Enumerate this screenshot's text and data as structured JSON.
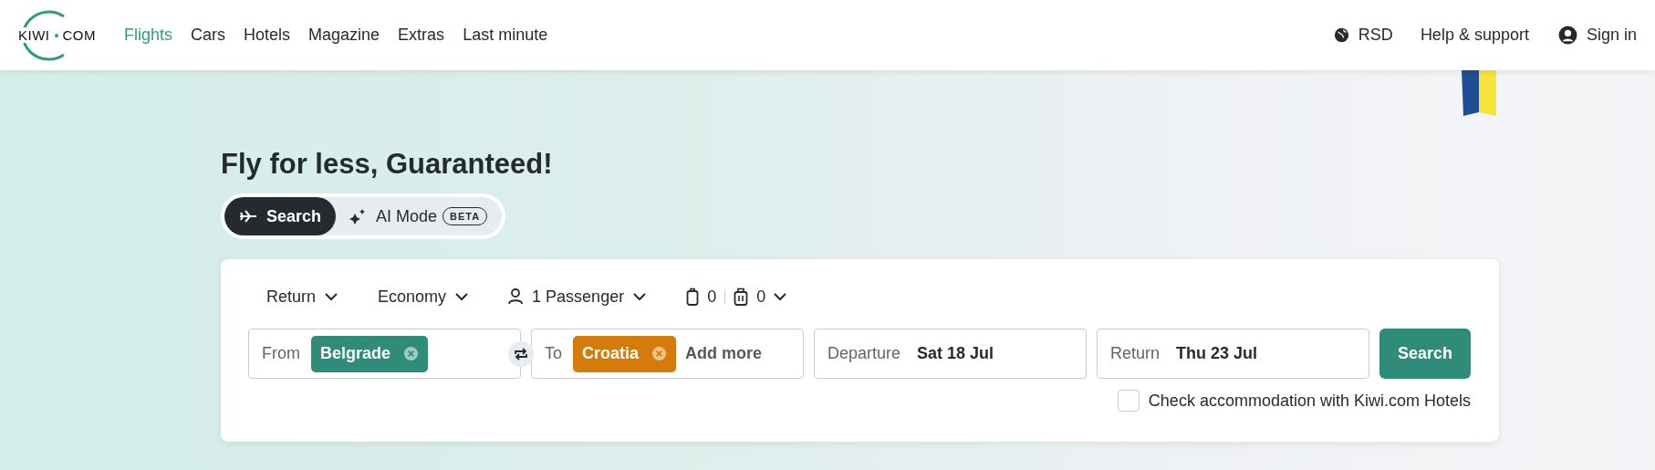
{
  "logo": {
    "left": "KIWI",
    "right": "COM"
  },
  "nav": [
    {
      "label": "Flights",
      "selected": true
    },
    {
      "label": "Cars",
      "selected": false
    },
    {
      "label": "Hotels",
      "selected": false
    },
    {
      "label": "Magazine",
      "selected": false
    },
    {
      "label": "Extras",
      "selected": false
    },
    {
      "label": "Last minute",
      "selected": false
    }
  ],
  "header_right": {
    "currency": "RSD",
    "help": "Help & support",
    "sign_in": "Sign in"
  },
  "hero": {
    "title": "Fly for less, Guaranteed!"
  },
  "modes": [
    {
      "kind": "plane",
      "label": "Search",
      "selected": true
    },
    {
      "kind": "sparkle",
      "label": "AI Mode",
      "badge": "BETA",
      "selected": false
    }
  ],
  "options": [
    {
      "kind": "dropdown",
      "label": "Return"
    },
    {
      "kind": "dropdown",
      "label": "Economy"
    },
    {
      "kind": "passenger",
      "label": "1 Passenger"
    },
    {
      "kind": "bags",
      "cabin": "0",
      "checked": "0"
    }
  ],
  "fields": [
    {
      "kind": "places",
      "label": "From",
      "chips": [
        {
          "text": "Belgrade",
          "color": "#2f8c78"
        }
      ]
    },
    {
      "kind": "places",
      "label": "To",
      "chips": [
        {
          "text": "Croatia",
          "color": "#d57b0b"
        }
      ],
      "placeholder": "Add more"
    },
    {
      "kind": "date",
      "label": "Departure",
      "value": "Sat 18 Jul"
    },
    {
      "kind": "date",
      "label": "Return",
      "value": "Thu 23 Jul"
    }
  ],
  "search_button": "Search",
  "accommodation": {
    "label": "Check accommodation with Kiwi.com Hotels",
    "checked": false
  }
}
